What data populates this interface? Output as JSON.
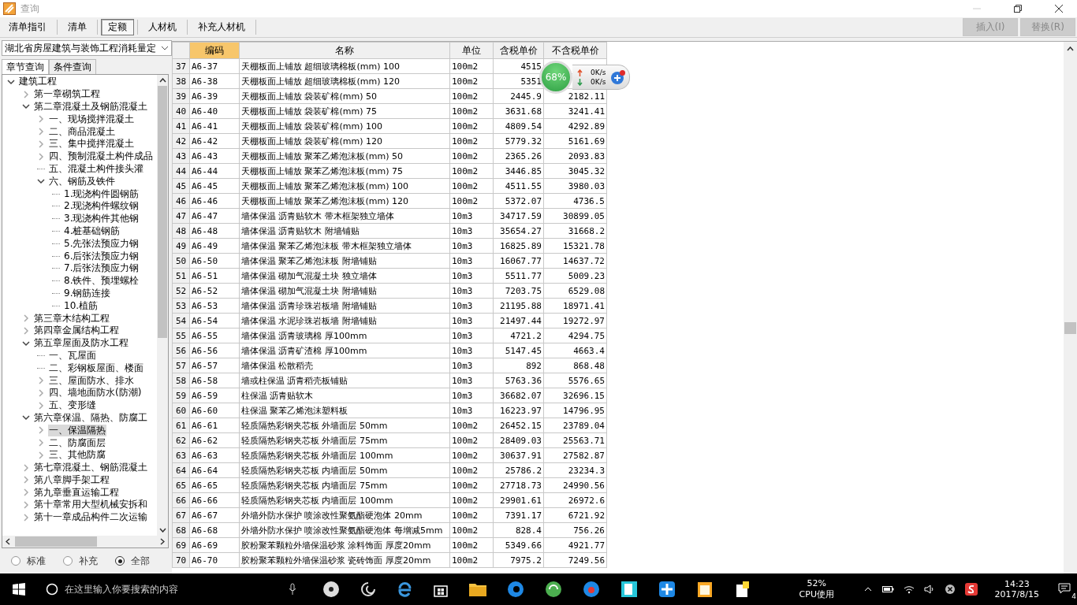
{
  "window": {
    "title": "查询"
  },
  "toolbar": {
    "tabs": [
      {
        "label": "清单指引",
        "selected": false
      },
      {
        "label": "清单",
        "selected": false
      },
      {
        "label": "定额",
        "selected": true
      },
      {
        "label": "人材机",
        "selected": false
      },
      {
        "label": "补充人材机",
        "selected": false
      }
    ],
    "buttons": [
      {
        "label": "插入(I)",
        "disabled": true
      },
      {
        "label": "替换(R)",
        "disabled": true
      }
    ]
  },
  "library": {
    "value": "湖北省房屋建筑与装饰工程消耗量定"
  },
  "query_tabs": [
    {
      "label": "章节查询",
      "selected": true
    },
    {
      "label": "条件查询",
      "selected": false
    }
  ],
  "tree": {
    "items": [
      {
        "label": "建筑工程",
        "expanded": true,
        "selected": false,
        "children": [
          {
            "label": "第一章砌筑工程",
            "expanded": false,
            "selected": false
          },
          {
            "label": "第二章混凝土及钢筋混凝土",
            "expanded": true,
            "selected": false,
            "children": [
              {
                "label": "一、现场搅拌混凝土",
                "expanded": false,
                "selected": false
              },
              {
                "label": "二、商品混凝土",
                "expanded": false,
                "selected": false
              },
              {
                "label": "三、集中搅拌混凝土",
                "expanded": false,
                "selected": false
              },
              {
                "label": "四、预制混凝土构件成品",
                "expanded": false,
                "selected": false
              },
              {
                "label": "五、混凝土构件接头灌",
                "selected": false
              },
              {
                "label": "六、钢筋及铁件",
                "expanded": true,
                "selected": false,
                "children": [
                  {
                    "label": "1.现浇构件圆钢筋",
                    "selected": false
                  },
                  {
                    "label": "2.现浇构件螺纹钢",
                    "selected": false
                  },
                  {
                    "label": "3.现浇构件其他钢",
                    "selected": false
                  },
                  {
                    "label": "4.桩基础钢筋",
                    "selected": false
                  },
                  {
                    "label": "5.先张法预应力钢",
                    "selected": false
                  },
                  {
                    "label": "6.后张法预应力钢",
                    "selected": false
                  },
                  {
                    "label": "7.后张法预应力钢",
                    "selected": false
                  },
                  {
                    "label": "8.铁件、预埋螺栓",
                    "selected": false
                  },
                  {
                    "label": "9.钢筋连接",
                    "selected": false
                  },
                  {
                    "label": "10.植筋",
                    "selected": false
                  }
                ]
              }
            ]
          },
          {
            "label": "第三章木结构工程",
            "expanded": false,
            "selected": false
          },
          {
            "label": "第四章金属结构工程",
            "expanded": false,
            "selected": false
          },
          {
            "label": "第五章屋面及防水工程",
            "expanded": true,
            "selected": false,
            "children": [
              {
                "label": "一、瓦屋面",
                "selected": false
              },
              {
                "label": "二、彩钢板屋面、楼面",
                "selected": false
              },
              {
                "label": "三、屋面防水、排水",
                "expanded": false,
                "selected": false
              },
              {
                "label": "四、墙地面防水(防潮)",
                "expanded": false,
                "selected": false
              },
              {
                "label": "五、变形缝",
                "expanded": false,
                "selected": false
              }
            ]
          },
          {
            "label": "第六章保温、隔热、防腐工",
            "expanded": true,
            "selected": false,
            "children": [
              {
                "label": "一、保温隔热",
                "expanded": false,
                "selected": true
              },
              {
                "label": "二、防腐面层",
                "expanded": false,
                "selected": false
              },
              {
                "label": "三、其他防腐",
                "expanded": false,
                "selected": false
              }
            ]
          },
          {
            "label": "第七章混凝土、钢筋混凝土",
            "expanded": false,
            "selected": false
          },
          {
            "label": "第八章脚手架工程",
            "expanded": false,
            "selected": false
          },
          {
            "label": "第九章垂直运输工程",
            "expanded": false,
            "selected": false
          },
          {
            "label": "第十章常用大型机械安拆和",
            "expanded": false,
            "selected": false
          },
          {
            "label": "第十一章成品构件二次运输",
            "expanded": false,
            "selected": false
          }
        ]
      }
    ]
  },
  "filter": [
    {
      "label": "标准",
      "selected": false
    },
    {
      "label": "补充",
      "selected": false
    },
    {
      "label": "全部",
      "selected": true
    }
  ],
  "table": {
    "columns": [
      {
        "label": "编码",
        "selected": true
      },
      {
        "label": "名称",
        "selected": false
      },
      {
        "label": "单位",
        "selected": false
      },
      {
        "label": "含税单价",
        "selected": false
      },
      {
        "label": "不含税单价",
        "selected": false
      }
    ],
    "rows": [
      {
        "no": "37",
        "code": "A6-37",
        "name": "天棚板面上铺放 超细玻璃棉板(mm) 100",
        "unit": "100m2",
        "price_tax": "4515"
      },
      {
        "no": "38",
        "code": "A6-38",
        "name": "天棚板面上铺放 超细玻璃棉板(mm) 120",
        "unit": "100m2",
        "price_tax": "5351"
      },
      {
        "no": "39",
        "code": "A6-39",
        "name": "天棚板面上铺放 袋装矿棉(mm) 50",
        "unit": "100m2",
        "price_tax": "2445.9",
        "price_ex": "2182.11"
      },
      {
        "no": "40",
        "code": "A6-40",
        "name": "天棚板面上铺放 袋装矿棉(mm) 75",
        "unit": "100m2",
        "price_tax": "3631.68",
        "price_ex": "3241.41"
      },
      {
        "no": "41",
        "code": "A6-41",
        "name": "天棚板面上铺放 袋装矿棉(mm) 100",
        "unit": "100m2",
        "price_tax": "4809.54",
        "price_ex": "4292.89"
      },
      {
        "no": "42",
        "code": "A6-42",
        "name": "天棚板面上铺放 袋装矿棉(mm) 120",
        "unit": "100m2",
        "price_tax": "5779.32",
        "price_ex": "5161.69"
      },
      {
        "no": "43",
        "code": "A6-43",
        "name": "天棚板面上铺放 聚苯乙烯泡沫板(mm) 50",
        "unit": "100m2",
        "price_tax": "2365.26",
        "price_ex": "2093.83"
      },
      {
        "no": "44",
        "code": "A6-44",
        "name": "天棚板面上铺放 聚苯乙烯泡沫板(mm) 75",
        "unit": "100m2",
        "price_tax": "3446.85",
        "price_ex": "3045.32"
      },
      {
        "no": "45",
        "code": "A6-45",
        "name": "天棚板面上铺放 聚苯乙烯泡沫板(mm) 100",
        "unit": "100m2",
        "price_tax": "4511.55",
        "price_ex": "3980.03"
      },
      {
        "no": "46",
        "code": "A6-46",
        "name": "天棚板面上铺放 聚苯乙烯泡沫板(mm) 120",
        "unit": "100m2",
        "price_tax": "5372.07",
        "price_ex": "4736.5"
      },
      {
        "no": "47",
        "code": "A6-47",
        "name": "墙体保温 沥青贴软木 带木框架独立墙体",
        "unit": "10m3",
        "price_tax": "34717.59",
        "price_ex": "30899.05"
      },
      {
        "no": "48",
        "code": "A6-48",
        "name": "墙体保温 沥青贴软木 附墙铺贴",
        "unit": "10m3",
        "price_tax": "35654.27",
        "price_ex": "31668.2"
      },
      {
        "no": "49",
        "code": "A6-49",
        "name": "墙体保温 聚苯乙烯泡沫板 带木框架独立墙体",
        "unit": "10m3",
        "price_tax": "16825.89",
        "price_ex": "15321.78"
      },
      {
        "no": "50",
        "code": "A6-50",
        "name": "墙体保温 聚苯乙烯泡沫板 附墙铺贴",
        "unit": "10m3",
        "price_tax": "16067.77",
        "price_ex": "14637.72"
      },
      {
        "no": "51",
        "code": "A6-51",
        "name": "墙体保温 砌加气混凝土块 独立墙体",
        "unit": "10m3",
        "price_tax": "5511.77",
        "price_ex": "5009.23"
      },
      {
        "no": "52",
        "code": "A6-52",
        "name": "墙体保温 砌加气混凝土块 附墙铺贴",
        "unit": "10m3",
        "price_tax": "7203.75",
        "price_ex": "6529.08"
      },
      {
        "no": "53",
        "code": "A6-53",
        "name": "墙体保温 沥青珍珠岩板墙 附墙铺贴",
        "unit": "10m3",
        "price_tax": "21195.88",
        "price_ex": "18971.41"
      },
      {
        "no": "54",
        "code": "A6-54",
        "name": "墙体保温 水泥珍珠岩板墙 附墙铺贴",
        "unit": "10m3",
        "price_tax": "21497.44",
        "price_ex": "19272.97"
      },
      {
        "no": "55",
        "code": "A6-55",
        "name": "墙体保温 沥青玻璃棉 厚100mm",
        "unit": "10m3",
        "price_tax": "4721.2",
        "price_ex": "4294.75"
      },
      {
        "no": "56",
        "code": "A6-56",
        "name": "墙体保温 沥青矿渣棉 厚100mm",
        "unit": "10m3",
        "price_tax": "5147.45",
        "price_ex": "4663.4"
      },
      {
        "no": "57",
        "code": "A6-57",
        "name": "墙体保温 松散稻壳",
        "unit": "10m3",
        "price_tax": "892",
        "price_ex": "868.48"
      },
      {
        "no": "58",
        "code": "A6-58",
        "name": "墙或柱保温 沥青稻壳板铺贴",
        "unit": "10m3",
        "price_tax": "5763.36",
        "price_ex": "5576.65"
      },
      {
        "no": "59",
        "code": "A6-59",
        "name": "柱保温 沥青贴软木",
        "unit": "10m3",
        "price_tax": "36682.07",
        "price_ex": "32696.15"
      },
      {
        "no": "60",
        "code": "A6-60",
        "name": "柱保温 聚苯乙烯泡沫塑料板",
        "unit": "10m3",
        "price_tax": "16223.97",
        "price_ex": "14796.95"
      },
      {
        "no": "61",
        "code": "A6-61",
        "name": "轻质隔热彩钢夹芯板 外墙面层 50mm",
        "unit": "100m2",
        "price_tax": "26452.15",
        "price_ex": "23789.04"
      },
      {
        "no": "62",
        "code": "A6-62",
        "name": "轻质隔热彩钢夹芯板 外墙面层 75mm",
        "unit": "100m2",
        "price_tax": "28409.03",
        "price_ex": "25563.71"
      },
      {
        "no": "63",
        "code": "A6-63",
        "name": "轻质隔热彩钢夹芯板 外墙面层 100mm",
        "unit": "100m2",
        "price_tax": "30637.91",
        "price_ex": "27582.87"
      },
      {
        "no": "64",
        "code": "A6-64",
        "name": "轻质隔热彩钢夹芯板 内墙面层 50mm",
        "unit": "100m2",
        "price_tax": "25786.2",
        "price_ex": "23234.3"
      },
      {
        "no": "65",
        "code": "A6-65",
        "name": "轻质隔热彩钢夹芯板 内墙面层 75mm",
        "unit": "100m2",
        "price_tax": "27718.73",
        "price_ex": "24990.56"
      },
      {
        "no": "66",
        "code": "A6-66",
        "name": "轻质隔热彩钢夹芯板 内墙面层 100mm",
        "unit": "100m2",
        "price_tax": "29901.61",
        "price_ex": "26972.6"
      },
      {
        "no": "67",
        "code": "A6-67",
        "name": "外墙外防水保护 喷涂改性聚氨酯硬泡体 20mm",
        "unit": "100m2",
        "price_tax": "7391.17",
        "price_ex": "6721.92"
      },
      {
        "no": "68",
        "code": "A6-68",
        "name": "外墙外防水保护 喷涂改性聚氨酯硬泡体 每增减5mm",
        "unit": "100m2",
        "price_tax": "828.4",
        "price_ex": "756.26"
      },
      {
        "no": "69",
        "code": "A6-69",
        "name": "胶粉聚苯颗粒外墙保温砂浆 涂料饰面 厚度20mm",
        "unit": "100m2",
        "price_tax": "5349.66",
        "price_ex": "4921.77"
      },
      {
        "no": "70",
        "code": "A6-70",
        "name": "胶粉聚苯颗粒外墙保温砂浆 瓷砖饰面 厚度20mm",
        "unit": "100m2",
        "price_tax": "7975.2",
        "price_ex": "7249.56"
      }
    ]
  },
  "net_monitor": {
    "percent": "68%",
    "upload": "0K/s",
    "download": "0K/s"
  },
  "taskbar": {
    "search_placeholder": "在这里输入你要搜索的内容",
    "cpu_percent": "52%",
    "cpu_label": "CPU使用",
    "time": "14:23",
    "date": "2017/8/15",
    "notifications": "4"
  }
}
